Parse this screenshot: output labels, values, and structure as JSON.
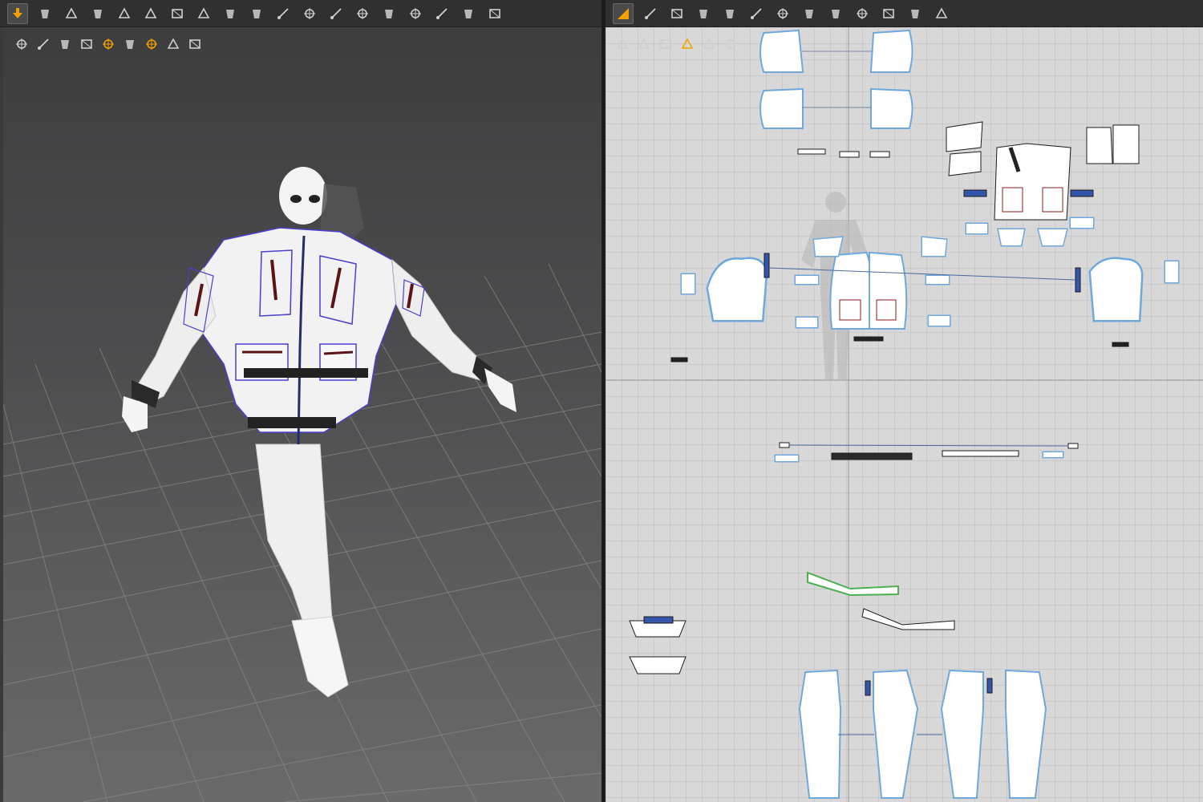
{
  "viewport3d": {
    "toolbar_icons": [
      "simulate-icon",
      "select-move-icon",
      "edit-pattern-icon",
      "fold-arrangement-icon",
      "edit-pin-icon",
      "gizmo-icon",
      "tack-icon",
      "arrangement-point-icon",
      "select-mesh-icon",
      "texture-grid-icon",
      "measure-icon",
      "transform-icon",
      "avatar-pin-icon",
      "garment-fit-icon",
      "shrink-icon",
      "stitch-icon",
      "pose-icon",
      "brush-icon",
      "run-avatar-icon"
    ],
    "subbar_icons": [
      "show-avatar-icon",
      "show-garment-icon",
      "fabric-render-icon",
      "avatar-display-icon",
      "pattern-face-icon",
      "light-icon",
      "skin-icon",
      "texture-icon",
      "export-icon"
    ],
    "active_tool": "simulate-icon"
  },
  "viewport2d": {
    "toolbar_icons": [
      "transform-pattern-icon",
      "edit-point-icon",
      "create-polygon-icon",
      "create-rectangle-icon",
      "internal-line-icon",
      "segment-sewing-icon",
      "grid-pattern-icon",
      "trace-icon",
      "fold-icon",
      "seam-taping-icon",
      "topstitch-icon",
      "cut-icon",
      "garment-icon"
    ],
    "subbar_icons": [
      "pattern-edit-icon",
      "sewing-display-icon",
      "info-icon",
      "pattern-color-icon",
      "avatar-silhouette-icon",
      "export-pattern-icon"
    ],
    "active_tool": "transform-pattern-icon"
  },
  "colors": {
    "accent": "#f2a100",
    "selection_blue": "#6fa8dc",
    "seam_blue": "#3355aa",
    "stitch_red": "#8b1a1a",
    "selected_green": "#4caf50"
  }
}
